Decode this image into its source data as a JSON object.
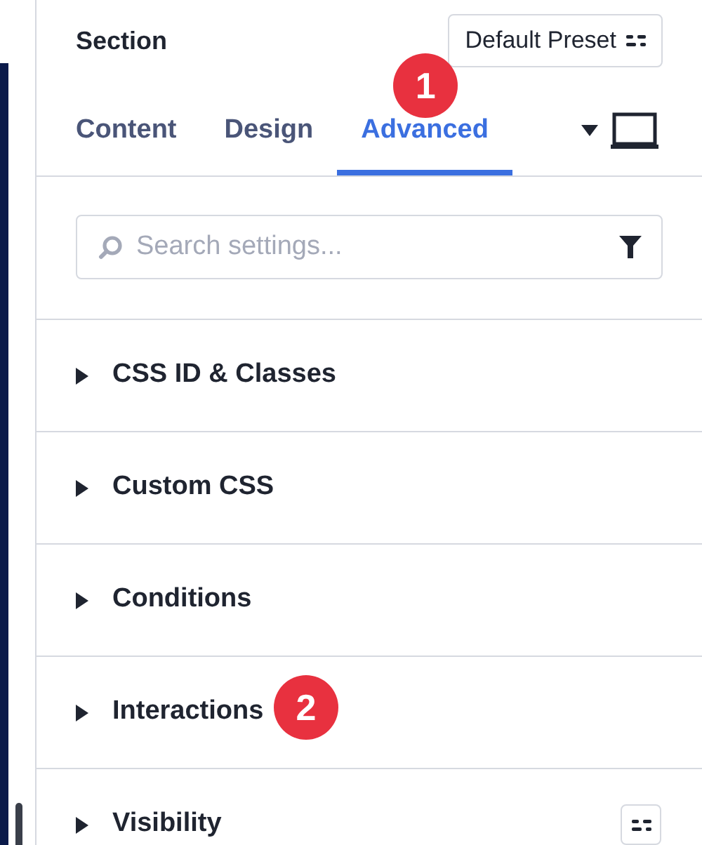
{
  "panel": {
    "title": "Section",
    "preset_button": "Default Preset"
  },
  "tabs": [
    {
      "label": "Content",
      "selected": false
    },
    {
      "label": "Design",
      "selected": false
    },
    {
      "label": "Advanced",
      "selected": true,
      "badge": "1"
    }
  ],
  "search": {
    "placeholder": "Search settings..."
  },
  "sections": [
    {
      "label": "CSS ID & Classes",
      "expanded": false,
      "has_preset": false
    },
    {
      "label": "Custom CSS",
      "expanded": false,
      "has_preset": false
    },
    {
      "label": "Conditions",
      "expanded": false,
      "has_preset": false
    },
    {
      "label": "Interactions",
      "expanded": false,
      "has_preset": false,
      "badge": "2"
    },
    {
      "label": "Visibility",
      "expanded": false,
      "has_preset": true
    }
  ]
}
